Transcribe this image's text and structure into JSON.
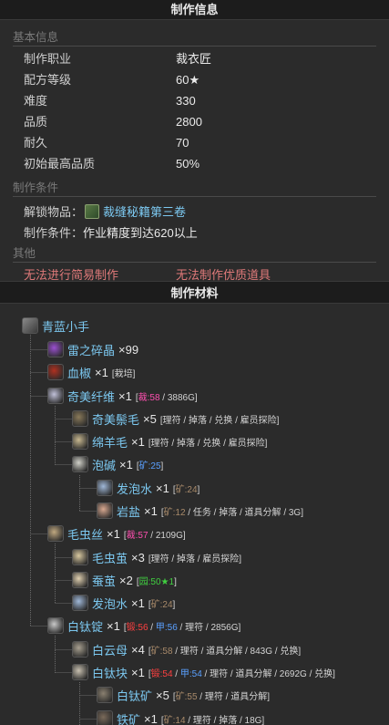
{
  "info_header": "制作信息",
  "basic_title": "基本信息",
  "basic": [
    {
      "k": "制作职业",
      "v": "裁衣匠"
    },
    {
      "k": "配方等级",
      "v": "60★"
    },
    {
      "k": "难度",
      "v": "330"
    },
    {
      "k": "品质",
      "v": "2800"
    },
    {
      "k": "耐久",
      "v": "70"
    },
    {
      "k": "初始最高品质",
      "v": "50%"
    }
  ],
  "cond_title": "制作条件",
  "unlock_label": "解锁物品：",
  "unlock_item": "裁缝秘籍第三卷",
  "cond_label": "制作条件：",
  "cond_value": "作业精度到达620以上",
  "other_title": "其他",
  "other_a": "无法进行简易制作",
  "other_b": "无法制作优质道具",
  "mat_header": "制作材料",
  "tree": [
    {
      "name": "青蓝小手",
      "qty": "",
      "src": [],
      "icon": "weapon-icon",
      "color": "#7a7a7a"
    },
    {
      "name": "雷之碎晶",
      "qty": "×99",
      "src": [],
      "icon": "crystal-icon",
      "color": "#9a50d0"
    },
    {
      "name": "血椒",
      "qty": "×1",
      "src": [
        {
          "t": "[栽培]",
          "c": ""
        }
      ],
      "icon": "pepper-icon",
      "color": "#b03020"
    },
    {
      "name": "奇美纤维",
      "qty": "×1",
      "src": [
        {
          "t": "[",
          "c": ""
        },
        {
          "t": "裁:58",
          "c": "c-pink"
        },
        {
          "t": " / 3886G]",
          "c": ""
        }
      ],
      "icon": "fiber-icon",
      "color": "#c0c0d8"
    },
    {
      "name": "奇美鬃毛",
      "qty": "×5",
      "src": [
        {
          "t": "[理符 / 掉落 / 兑换 / 雇员探险]",
          "c": ""
        }
      ],
      "icon": "mane-icon",
      "color": "#8a7a5a"
    },
    {
      "name": "绵羊毛",
      "qty": "×1",
      "src": [
        {
          "t": "[理符 / 掉落 / 兑换 / 雇员探险]",
          "c": ""
        }
      ],
      "icon": "wool-icon",
      "color": "#c8b890"
    },
    {
      "name": "泡碱",
      "qty": "×1",
      "src": [
        {
          "t": "[",
          "c": ""
        },
        {
          "t": "矿:25",
          "c": "c-blue"
        },
        {
          "t": "]",
          "c": ""
        }
      ],
      "icon": "natron-icon",
      "color": "#d0d0c8"
    },
    {
      "name": "发泡水",
      "qty": "×1",
      "src": [
        {
          "t": "[",
          "c": ""
        },
        {
          "t": "矿:24",
          "c": "c-ore"
        },
        {
          "t": "]",
          "c": ""
        }
      ],
      "icon": "water-icon",
      "color": "#a0b8d8"
    },
    {
      "name": "岩盐",
      "qty": "×1",
      "src": [
        {
          "t": "[",
          "c": ""
        },
        {
          "t": "矿:12",
          "c": "c-ore"
        },
        {
          "t": " / 任务 / 掉落 / 道具分解 / 3G]",
          "c": ""
        }
      ],
      "icon": "salt-icon",
      "color": "#d8a890"
    },
    {
      "name": "毛虫丝",
      "qty": "×1",
      "src": [
        {
          "t": "[",
          "c": ""
        },
        {
          "t": "裁:57",
          "c": "c-pink"
        },
        {
          "t": " / 2109G]",
          "c": ""
        }
      ],
      "icon": "silk-icon",
      "color": "#c0a880"
    },
    {
      "name": "毛虫茧",
      "qty": "×3",
      "src": [
        {
          "t": "[理符 / 掉落 / 雇员探险]",
          "c": ""
        }
      ],
      "icon": "cocoon-icon",
      "color": "#d8c8a0"
    },
    {
      "name": "蚕茧",
      "qty": "×2",
      "src": [
        {
          "t": "[",
          "c": ""
        },
        {
          "t": "园:50★1",
          "c": "c-green"
        },
        {
          "t": "]",
          "c": ""
        }
      ],
      "icon": "cocoon-icon",
      "color": "#e0d0b0"
    },
    {
      "name": "发泡水",
      "qty": "×1",
      "src": [
        {
          "t": "[",
          "c": ""
        },
        {
          "t": "矿:24",
          "c": "c-ore"
        },
        {
          "t": "]",
          "c": ""
        }
      ],
      "icon": "water-icon",
      "color": "#a0b8d8"
    },
    {
      "name": "白钛锭",
      "qty": "×1",
      "src": [
        {
          "t": "[",
          "c": ""
        },
        {
          "t": "锻:56",
          "c": "c-red"
        },
        {
          "t": " / ",
          "c": ""
        },
        {
          "t": "甲:56",
          "c": "c-blue"
        },
        {
          "t": " / 理符 / 2856G]",
          "c": ""
        }
      ],
      "icon": "ingot-icon",
      "color": "#c8c8c8"
    },
    {
      "name": "白云母",
      "qty": "×4",
      "src": [
        {
          "t": "[",
          "c": ""
        },
        {
          "t": "矿:58",
          "c": "c-ore"
        },
        {
          "t": " / 理符 / 道具分解 / 843G / 兑换]",
          "c": ""
        }
      ],
      "icon": "mica-icon",
      "color": "#a8a090"
    },
    {
      "name": "白钛块",
      "qty": "×1",
      "src": [
        {
          "t": "[",
          "c": ""
        },
        {
          "t": "锻:54",
          "c": "c-red"
        },
        {
          "t": " / ",
          "c": ""
        },
        {
          "t": "甲:54",
          "c": "c-blue"
        },
        {
          "t": " / 理符 / 道具分解 / 2692G / 兑换]",
          "c": ""
        }
      ],
      "icon": "nugget-icon",
      "color": "#c8c0b0"
    },
    {
      "name": "白钛矿",
      "qty": "×5",
      "src": [
        {
          "t": "[",
          "c": ""
        },
        {
          "t": "矿:55",
          "c": "c-ore"
        },
        {
          "t": " / 理符 / 道具分解]",
          "c": ""
        }
      ],
      "icon": "ore-icon",
      "color": "#8a8070"
    },
    {
      "name": "铁矿",
      "qty": "×1",
      "src": [
        {
          "t": "[",
          "c": ""
        },
        {
          "t": "矿:14",
          "c": "c-ore"
        },
        {
          "t": " / 理符 / 掉落 / 18G]",
          "c": ""
        }
      ],
      "icon": "ore-icon",
      "color": "#7a6a5a"
    }
  ]
}
